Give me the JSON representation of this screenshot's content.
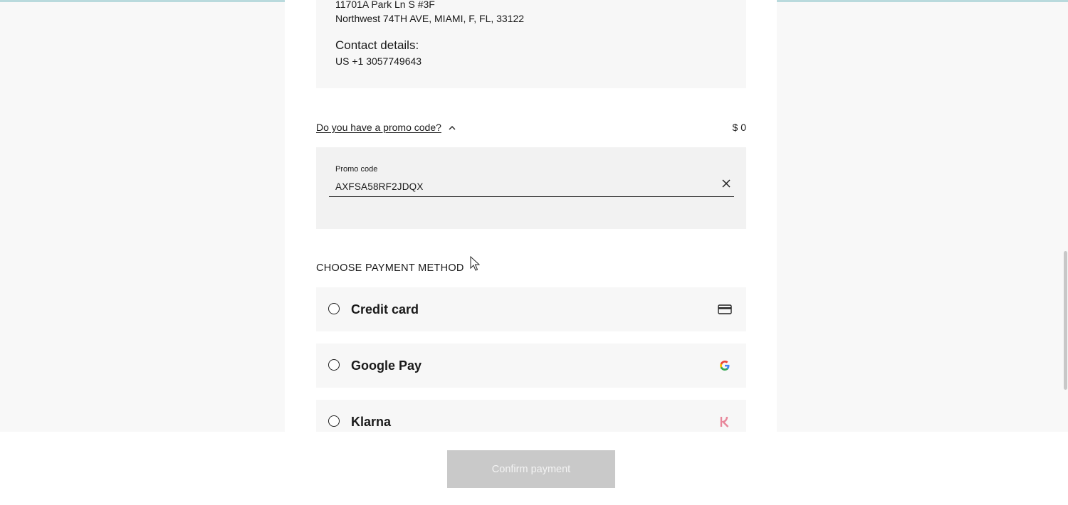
{
  "shipping": {
    "address_line1": "11701A Park Ln S #3F",
    "address_line2": "Northwest 74TH AVE, MIAMI, F, FL, 33122",
    "contact_title": "Contact details:",
    "contact_phone": "US +1 3057749643"
  },
  "promo": {
    "toggle_label": "Do you have a promo code?",
    "amount": "$ 0",
    "field_label": "Promo code",
    "field_value": "AXFSA58RF2JDQX",
    "expanded": true
  },
  "payment": {
    "heading": "CHOOSE PAYMENT METHOD",
    "methods": [
      {
        "label": "Credit card",
        "icon": "credit-card-icon",
        "selected": false
      },
      {
        "label": "Google Pay",
        "icon": "google-icon",
        "selected": false
      },
      {
        "label": "Klarna",
        "icon": "klarna-icon",
        "selected": false
      }
    ]
  },
  "footer": {
    "confirm_label": "Confirm payment",
    "confirm_enabled": false
  },
  "colors": {
    "accent_top": "#b9dadd",
    "button_disabled": "#c9c9c9",
    "klarna_pink": "#e8869a"
  }
}
